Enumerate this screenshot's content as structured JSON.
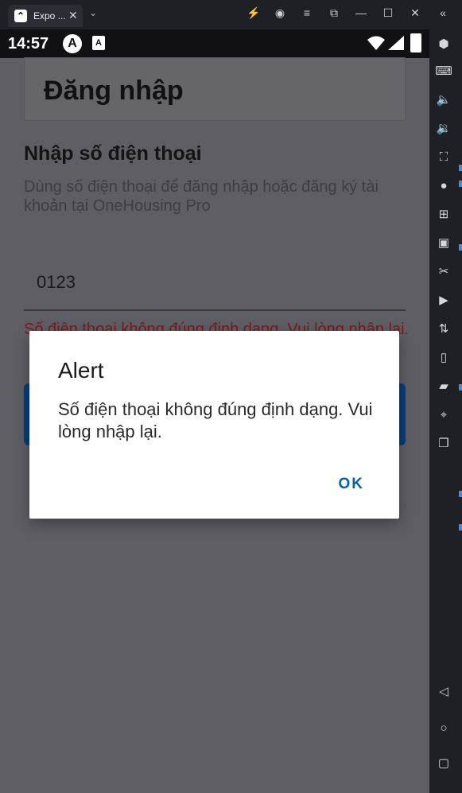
{
  "window": {
    "tab_title": "Expo ...",
    "tab_close": "✕",
    "tab_dropdown": "⌄"
  },
  "statusbar": {
    "time": "14:57",
    "icon_a": "A",
    "icon_a2": "A"
  },
  "page": {
    "title": "Đăng nhập",
    "section_title": "Nhập số điện thoại",
    "description": "Dùng số điện thoại để đăng nhập hoặc đăng ký tài khoản tại OneHousing Pro",
    "phone_value": "0123",
    "error": "Số điện thoại không đúng định dạng. Vui lòng nhập lại."
  },
  "dialog": {
    "title": "Alert",
    "message": "Số điện thoại không đúng định dạng. Vui lòng nhập lại.",
    "ok_label": "OK"
  },
  "colors": {
    "accent": "#0a61a3",
    "error": "#b41e1e",
    "button": "#0b3d78"
  }
}
